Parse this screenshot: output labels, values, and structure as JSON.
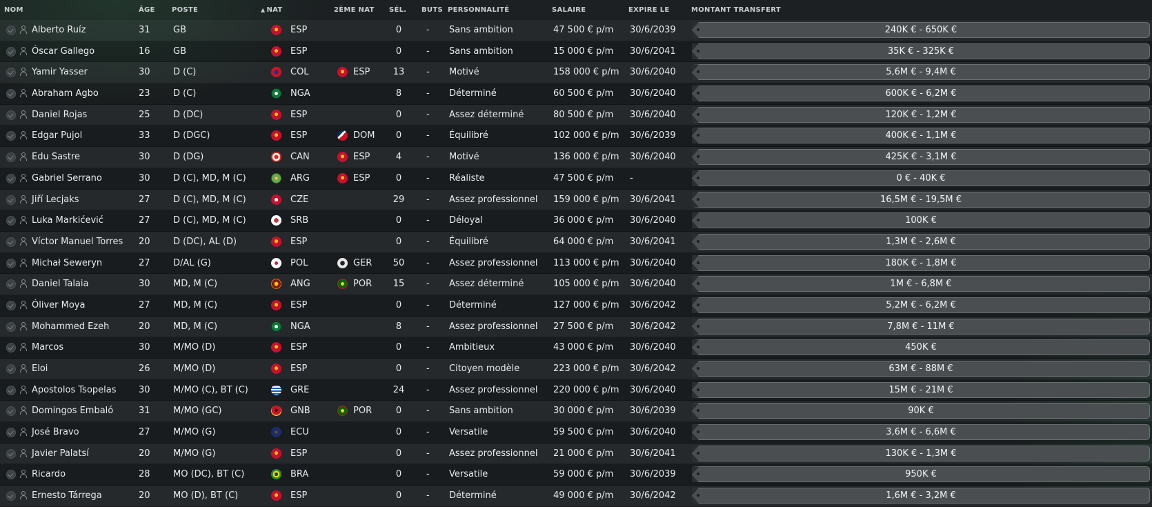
{
  "headers": {
    "name": "NOM",
    "age": "ÂGE",
    "position": "POSTE",
    "nat": "NAT",
    "nat2": "2ÈME NAT",
    "caps": "SÉL.",
    "goals": "BUTS",
    "personality": "PERSONNALITÉ",
    "wage": "SALAIRE",
    "expires": "EXPIRE LE",
    "transfer_value": "MONTANT TRANSFERT"
  },
  "sort_icon": "triangle-up-icon",
  "players": [
    {
      "name": "Alberto Ruíz",
      "age": "31",
      "position": "GB",
      "nat": "ESP",
      "nat2": "",
      "caps": "0",
      "goals": "-",
      "personality": "Sans ambition",
      "wage": "47 500 € p/m",
      "expires": "30/6/2039",
      "value": "240K € - 650K €"
    },
    {
      "name": "Óscar Gallego",
      "age": "16",
      "position": "GB",
      "nat": "ESP",
      "nat2": "",
      "caps": "0",
      "goals": "-",
      "personality": "Sans ambition",
      "wage": "15 000 € p/m",
      "expires": "30/6/2041",
      "value": "35K € - 325K €"
    },
    {
      "name": "Yamir Yasser",
      "age": "30",
      "position": "D (C)",
      "nat": "COL",
      "nat2": "ESP",
      "caps": "13",
      "goals": "-",
      "personality": "Motivé",
      "wage": "158 000 € p/m",
      "expires": "30/6/2040",
      "value": "5,6M € - 9,4M €"
    },
    {
      "name": "Abraham Agbo",
      "age": "23",
      "position": "D (C)",
      "nat": "NGA",
      "nat2": "",
      "caps": "8",
      "goals": "-",
      "personality": "Déterminé",
      "wage": "60 500 € p/m",
      "expires": "30/6/2040",
      "value": "600K € - 6,2M €"
    },
    {
      "name": "Daniel Rojas",
      "age": "25",
      "position": "D (DC)",
      "nat": "ESP",
      "nat2": "",
      "caps": "0",
      "goals": "-",
      "personality": "Assez déterminé",
      "wage": "80 500 € p/m",
      "expires": "30/6/2040",
      "value": "120K € - 1,2M €"
    },
    {
      "name": "Edgar Pujol",
      "age": "33",
      "position": "D (DGC)",
      "nat": "ESP",
      "nat2": "DOM",
      "caps": "0",
      "goals": "-",
      "personality": "Équilibré",
      "wage": "102 000 € p/m",
      "expires": "30/6/2039",
      "value": "400K € - 1,1M €"
    },
    {
      "name": "Edu Sastre",
      "age": "30",
      "position": "D (DG)",
      "nat": "CAN",
      "nat2": "ESP",
      "caps": "4",
      "goals": "-",
      "personality": "Motivé",
      "wage": "136 000 € p/m",
      "expires": "30/6/2040",
      "value": "425K € - 3,1M €"
    },
    {
      "name": "Gabriel Serrano",
      "age": "30",
      "position": "D (C), MD, M (C)",
      "nat": "ARG",
      "nat2": "ESP",
      "caps": "0",
      "goals": "-",
      "personality": "Réaliste",
      "wage": "47 500 € p/m",
      "expires": "-",
      "value": "0 € - 40K €"
    },
    {
      "name": "Jiří Lecjaks",
      "age": "27",
      "position": "D (C), MD, M (C)",
      "nat": "CZE",
      "nat2": "",
      "caps": "29",
      "goals": "-",
      "personality": "Assez professionnel",
      "wage": "159 000 € p/m",
      "expires": "30/6/2041",
      "value": "16,5M € - 19,5M €"
    },
    {
      "name": "Luka Markićević",
      "age": "27",
      "position": "D (C), MD, M (C)",
      "nat": "SRB",
      "nat2": "",
      "caps": "0",
      "goals": "-",
      "personality": "Déloyal",
      "wage": "36 000 € p/m",
      "expires": "30/6/2040",
      "value": "100K €"
    },
    {
      "name": "Víctor Manuel Torres",
      "age": "20",
      "position": "D (DC), AL (D)",
      "nat": "ESP",
      "nat2": "",
      "caps": "0",
      "goals": "-",
      "personality": "Équilibré",
      "wage": "64 000 € p/m",
      "expires": "30/6/2041",
      "value": "1,3M € - 2,6M €"
    },
    {
      "name": "Michał Seweryn",
      "age": "27",
      "position": "D/AL (G)",
      "nat": "POL",
      "nat2": "GER",
      "caps": "50",
      "goals": "-",
      "personality": "Assez professionnel",
      "wage": "113 000 € p/m",
      "expires": "30/6/2040",
      "value": "180K € - 1,8M €"
    },
    {
      "name": "Daniel Talaia",
      "age": "30",
      "position": "MD, M (C)",
      "nat": "ANG",
      "nat2": "POR",
      "caps": "15",
      "goals": "-",
      "personality": "Assez déterminé",
      "wage": "105 000 € p/m",
      "expires": "30/6/2040",
      "value": "1M € - 6,8M €"
    },
    {
      "name": "Óliver Moya",
      "age": "27",
      "position": "MD, M (C)",
      "nat": "ESP",
      "nat2": "",
      "caps": "0",
      "goals": "-",
      "personality": "Déterminé",
      "wage": "127 000 € p/m",
      "expires": "30/6/2042",
      "value": "5,2M € - 6,2M €"
    },
    {
      "name": "Mohammed Ezeh",
      "age": "20",
      "position": "MD, M (C)",
      "nat": "NGA",
      "nat2": "",
      "caps": "8",
      "goals": "-",
      "personality": "Assez professionnel",
      "wage": "27 500 € p/m",
      "expires": "30/6/2042",
      "value": "7,8M € - 11M €"
    },
    {
      "name": "Marcos",
      "age": "30",
      "position": "M/MO (D)",
      "nat": "ESP",
      "nat2": "",
      "caps": "0",
      "goals": "-",
      "personality": "Ambitieux",
      "wage": "43 000 € p/m",
      "expires": "30/6/2040",
      "value": "450K €"
    },
    {
      "name": "Eloi",
      "age": "26",
      "position": "M/MO (D)",
      "nat": "ESP",
      "nat2": "",
      "caps": "0",
      "goals": "-",
      "personality": "Citoyen modèle",
      "wage": "223 000 € p/m",
      "expires": "30/6/2042",
      "value": "63M € - 88M €"
    },
    {
      "name": "Apostolos Tsopelas",
      "age": "30",
      "position": "M/MO (C), BT (C)",
      "nat": "GRE",
      "nat2": "",
      "caps": "24",
      "goals": "-",
      "personality": "Assez professionnel",
      "wage": "220 000 € p/m",
      "expires": "30/6/2040",
      "value": "15M € - 21M €"
    },
    {
      "name": "Domingos Embaló",
      "age": "31",
      "position": "M/MO (GC)",
      "nat": "GNB",
      "nat2": "POR",
      "caps": "0",
      "goals": "-",
      "personality": "Sans ambition",
      "wage": "30 000 € p/m",
      "expires": "30/6/2039",
      "value": "90K €"
    },
    {
      "name": "José Bravo",
      "age": "27",
      "position": "M/MO (G)",
      "nat": "ECU",
      "nat2": "",
      "caps": "0",
      "goals": "-",
      "personality": "Versatile",
      "wage": "59 500 € p/m",
      "expires": "30/6/2040",
      "value": "3,6M € - 6,6M €"
    },
    {
      "name": "Javier Palatsí",
      "age": "20",
      "position": "M/MO (G)",
      "nat": "ESP",
      "nat2": "",
      "caps": "0",
      "goals": "-",
      "personality": "Assez professionnel",
      "wage": "21 000 € p/m",
      "expires": "30/6/2041",
      "value": "130K € - 1,3M €"
    },
    {
      "name": "Ricardo",
      "age": "28",
      "position": "MO (DC), BT (C)",
      "nat": "BRA",
      "nat2": "",
      "caps": "0",
      "goals": "-",
      "personality": "Versatile",
      "wage": "59 000 € p/m",
      "expires": "30/6/2039",
      "value": "950K €"
    },
    {
      "name": "Ernesto Tárrega",
      "age": "20",
      "position": "MO (D), BT (C)",
      "nat": "ESP",
      "nat2": "",
      "caps": "0",
      "goals": "-",
      "personality": "Déterminé",
      "wage": "49 000 € p/m",
      "expires": "30/6/2042",
      "value": "1,6M € - 3,2M €"
    }
  ]
}
